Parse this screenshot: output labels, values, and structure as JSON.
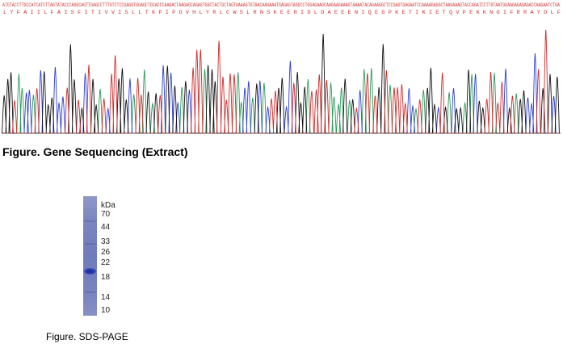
{
  "sequencing": {
    "caption": "Figure. Gene Sequencing (Extract)",
    "nucleotide_line": "ATGTACCTTGCCATCATCTTAGTATACCCAGGCAGTTGAGCCTTTGTCTCCGAGGTGGAGCTGCACCCAAGACTAAGAGCAGAGTGGCTACTGCTAGTGAAAGTGTAACAAGAAATGAGAGTAGGCCTGGAGAAGCAAGAAGAAAGTAAAATACAGAAGGCTCCGAGTGAGAATCCAAAAGAGGCTAAGAAAGTACCAGATCCTTGTAATGGAAGAGAGAGACCAAGAATCTGA",
    "aa_line": "L Y F A I I L F A I S F I T I V V I S L L T K P I P G V H L Y R L C W S L R N S K E E R I D L D A E E E N I Q E G P K E T I K I E T Q V P E K K N G I F R R A Y D L F"
  },
  "gel": {
    "caption": "Figure. SDS-PAGE",
    "unit": "kDa",
    "markers": [
      "70",
      "44",
      "33",
      "26",
      "22",
      "18",
      "14",
      "10"
    ]
  },
  "colors": {
    "seq_text": "#d33333",
    "trace_a": "#2a9a5a",
    "trace_c": "#2d3ed0",
    "trace_g": "#111111",
    "trace_t": "#d02a2a"
  }
}
